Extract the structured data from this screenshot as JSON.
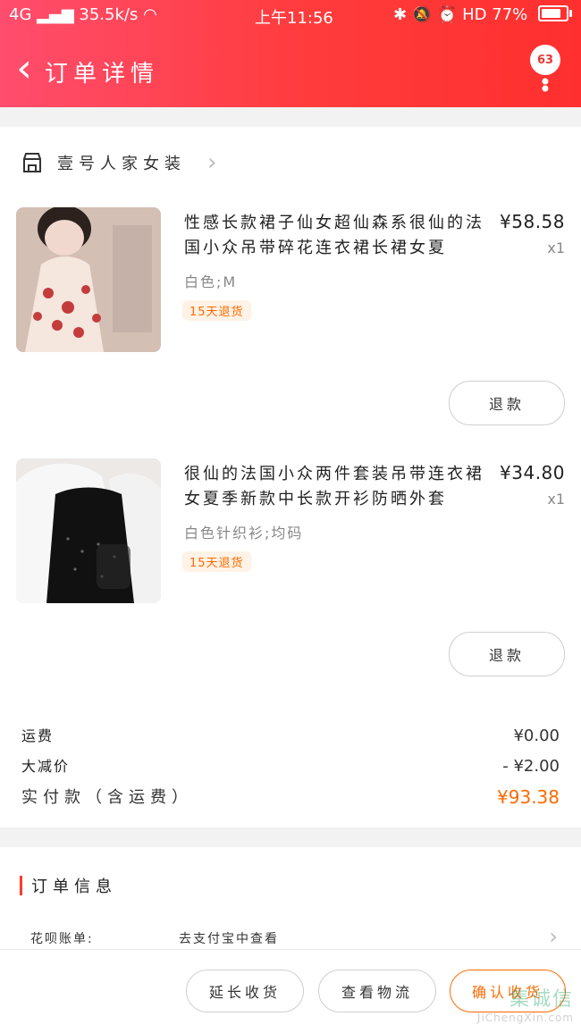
{
  "status_bar": {
    "network": "4G",
    "speed": "35.5k/s",
    "time": "上午11:56",
    "battery": "77%"
  },
  "header": {
    "title": "订单详情",
    "notification_count": "63"
  },
  "shop": {
    "name": "壹号人家女装"
  },
  "items": [
    {
      "title": "性感长款裙子仙女超仙森系很仙的法国小众吊带碎花连衣裙长裙女夏",
      "spec": "白色;M",
      "badge": "15天退货",
      "price": "¥58.58",
      "qty": "x1",
      "refund_label": "退款"
    },
    {
      "title": "很仙的法国小众两件套装吊带连衣裙女夏季新款中长款开衫防晒外套",
      "spec": "白色针织衫;均码",
      "badge": "15天退货",
      "price": "¥34.80",
      "qty": "x1",
      "refund_label": "退款"
    }
  ],
  "summary": {
    "shipping_label": "运费",
    "shipping_value": "¥0.00",
    "discount_label": "大减价",
    "discount_value": "- ¥2.00",
    "paid_label": "实付款（含运费）",
    "paid_value": "¥93.38"
  },
  "order_info": {
    "title": "订单信息",
    "huabei_label": "花呗账单:",
    "huabei_value": "去支付宝中查看"
  },
  "bottom_bar": {
    "extend_label": "延长收货",
    "logistics_label": "查看物流",
    "confirm_label": "确认收货"
  },
  "watermark": {
    "brand": "集诚信",
    "url": "JiChengXin.com"
  },
  "colors": {
    "header_start": "#ff4d6d",
    "header_end": "#ff2f2f",
    "accent": "#ff6a00"
  }
}
